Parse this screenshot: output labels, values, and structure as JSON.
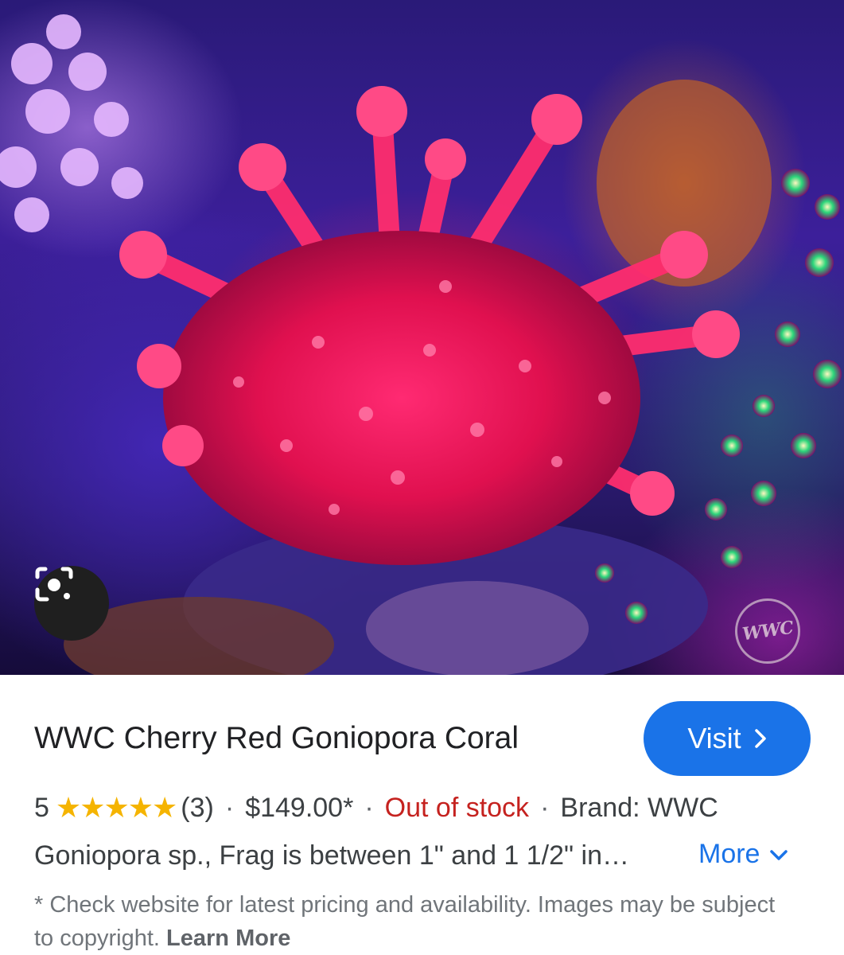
{
  "hero": {
    "image_subject": "red goniopora coral in reef aquarium",
    "watermark_text": "WWC",
    "lens_button": "camera-lens-icon"
  },
  "product": {
    "title": "WWC Cherry Red Goniopora Coral",
    "visit_label": "Visit",
    "rating_value": "5",
    "stars": "★★★★★",
    "review_count": "(3)",
    "price": "$149.00*",
    "stock_status": "Out of stock",
    "brand": "Brand: WWC",
    "description": "Goniopora sp., Frag is between 1\" and 1 1/2\" in…",
    "more_label": "More"
  },
  "disclaimer": {
    "text": "* Check website for latest pricing and availability. Images may be subject to copyright.",
    "link_label": "Learn More"
  },
  "colors": {
    "accent": "#1a73e8",
    "out_of_stock": "#c5221f",
    "star": "#f5b400"
  }
}
